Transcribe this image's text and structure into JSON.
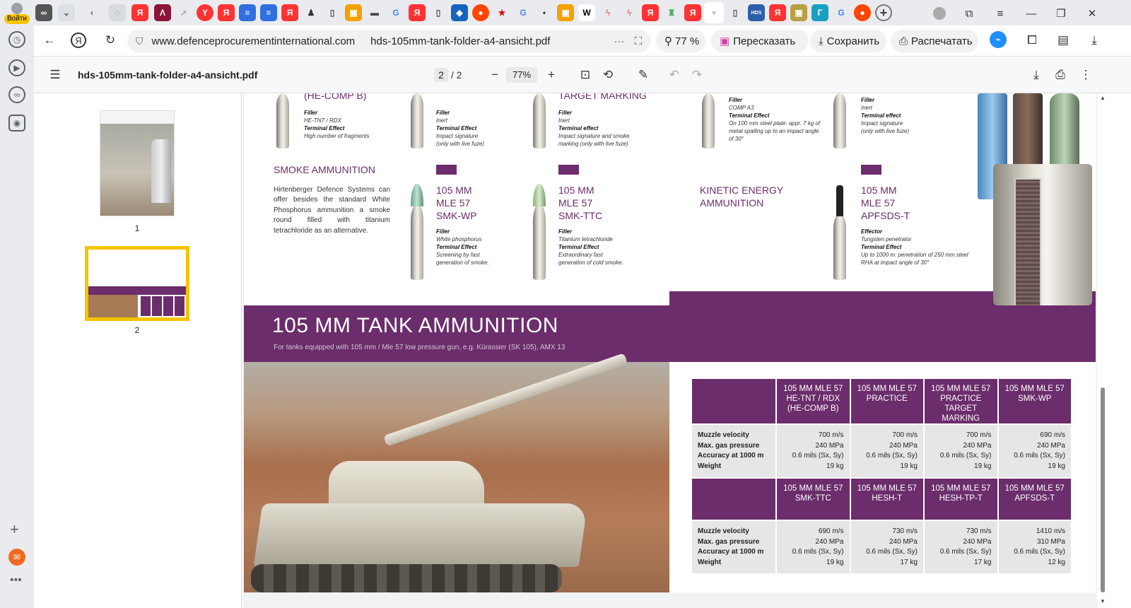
{
  "rail": {
    "login_label": "Войти"
  },
  "browser": {
    "url_domain": "www.defenceprocurementinternational.com",
    "url_title": "hds-105mm-tank-folder-a4-ansicht.pdf",
    "zoom_pill": "77 %",
    "retell": "Пересказать",
    "save": "Сохранить",
    "print": "Распечатать"
  },
  "pdf": {
    "filename": "hds-105mm-tank-folder-a4-ansicht.pdf",
    "page_current": "2",
    "page_total": "/ 2",
    "zoom": "77%",
    "thumb1": "1",
    "thumb2": "2"
  },
  "doc": {
    "top": [
      {
        "partial_title": "(HE-COMP B)",
        "l1": "Filler",
        "v1": "HE-TNT / RDX",
        "l2": "Terminal Effect",
        "v2": "High number of fragments"
      },
      {
        "l1": "Filler",
        "v1": "Inert",
        "l2": "Terminal Effect",
        "v2a": "Impact signature",
        "v2b": "(only with live fuze)"
      },
      {
        "partial_title": "TARGET MARKING",
        "l1": "Filler",
        "v1": "Inert",
        "l2": "Terminal effect",
        "v2a": "Impact signature and smoke",
        "v2b": "marking (only with live fuze)"
      },
      {
        "l1": "Filler",
        "v1": "COMP A3",
        "l2": "Terminal Effect",
        "v2a": "On 100 mm steel plate: appr. 7 kg of",
        "v2b": "metal spalling up to an impact angle",
        "v2c": "of 30°"
      },
      {
        "l1": "Filler",
        "v1": "Inert",
        "l2": "Terminal effect",
        "v2a": "Impact signature",
        "v2b": "(only with live fuze)"
      }
    ],
    "smoke_title": "SMOKE AMMUNITION",
    "smoke_text": "Hirtenberger Defence Systems can offer besides the standard White Phosphorus ammunition a smoke round filled with titanium tetrachloride as an alternative.",
    "kinetic_title_1": "KINETIC ENERGY",
    "kinetic_title_2": "AMMUNITION",
    "products": [
      {
        "n1": "105 MM",
        "n2": "MLE 57",
        "n3": "SMK-WP",
        "l1": "Filler",
        "v1": "White phosphorus",
        "l2": "Terminal Effect",
        "v2a": "Screening by fast",
        "v2b": "generation of smoke."
      },
      {
        "n1": "105 MM",
        "n2": "MLE 57",
        "n3": "SMK-TTC",
        "l1": "Filler",
        "v1": "Titanium tetrachloride",
        "l2": "Terminal Effect",
        "v2a": "Extraordinary fast",
        "v2b": "generation of cold smoke."
      },
      {
        "n1": "105 MM",
        "n2": "MLE 57",
        "n3": "APFSDS-T",
        "l1": "Effector",
        "v1": "Tungsten penetrator",
        "l2": "Terminal Effect",
        "v2a": "Up to 1000 m: penetration of 250 mm steel",
        "v2b": "RHA at impact angle of 30°"
      }
    ],
    "banner_title": "105 MM TANK AMMUNITION",
    "banner_sub": "For tanks equipped with 105 mm / Mle 57 low pressure gun, e.g. Kürassier (SK 105), AMX 13",
    "table": {
      "labels": [
        "Muzzle velocity",
        "Max. gas pressure",
        "Accuracy at 1000 m",
        "Weight"
      ],
      "group1": [
        {
          "h": [
            "105 MM MLE 57",
            "HE-TNT / RDX",
            "(HE-COMP B)"
          ],
          "v": [
            "700 m/s",
            "240 MPa",
            "0.6 mils (Sx, Sy)",
            "19 kg"
          ]
        },
        {
          "h": [
            "105 MM MLE 57",
            "PRACTICE"
          ],
          "v": [
            "700 m/s",
            "240 MPa",
            "0.6 mils (Sx, Sy)",
            "19 kg"
          ]
        },
        {
          "h": [
            "105 MM MLE 57",
            "PRACTICE",
            "TARGET MARKING"
          ],
          "v": [
            "700 m/s",
            "240 MPa",
            "0.6 mils (Sx, Sy)",
            "19 kg"
          ]
        },
        {
          "h": [
            "105 MM MLE 57",
            "SMK-WP"
          ],
          "v": [
            "690 m/s",
            "240 MPa",
            "0.6 mils (Sx, Sy)",
            "19 kg"
          ]
        }
      ],
      "group2": [
        {
          "h": [
            "105 MM MLE 57",
            "SMK-TTC"
          ],
          "v": [
            "690 m/s",
            "240 MPa",
            "0.6 mils (Sx, Sy)",
            "19 kg"
          ]
        },
        {
          "h": [
            "105 MM MLE 57",
            "HESH-T"
          ],
          "v": [
            "730 m/s",
            "240 MPa",
            "0.6 mils (Sx, Sy)",
            "17 kg"
          ]
        },
        {
          "h": [
            "105 MM MLE 57",
            "HESH-TP-T"
          ],
          "v": [
            "730 m/s",
            "240 MPa",
            "0.6 mils (Sx, Sy)",
            "17 kg"
          ]
        },
        {
          "h": [
            "105 MM MLE 57",
            "APFSDS-T"
          ],
          "v": [
            "1410 m/s",
            "310 MPa",
            "0.6 mils (Sx, Sy)",
            "12 kg"
          ]
        }
      ]
    }
  },
  "colors": {
    "brand_purple": "#6b2d6b",
    "thumb_highlight": "#f5c400"
  }
}
